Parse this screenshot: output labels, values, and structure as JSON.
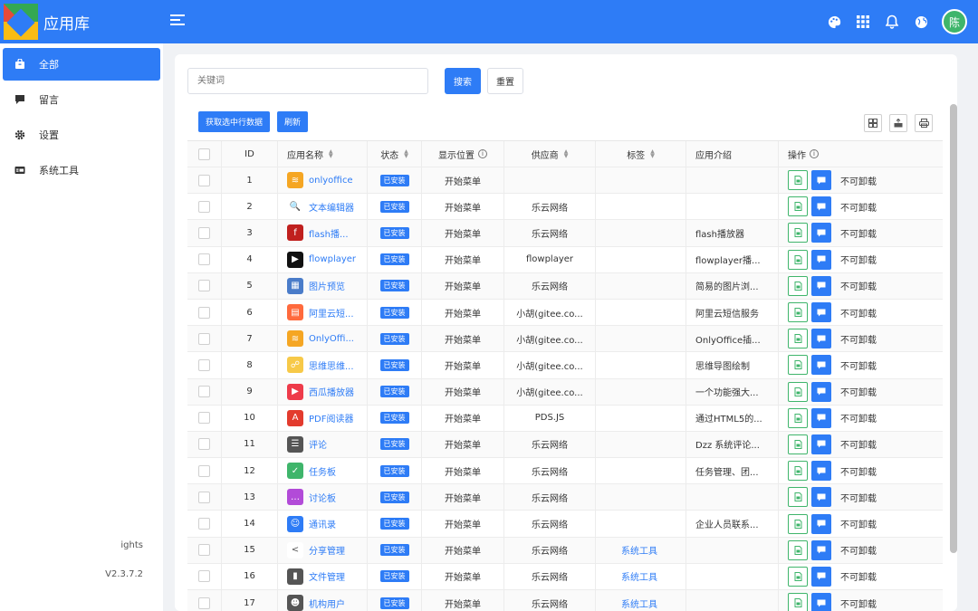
{
  "header": {
    "app_title": "应用库",
    "icons": [
      "menu-icon",
      "palette-icon",
      "apps-grid-icon",
      "bell-icon",
      "globe-icon"
    ],
    "avatar_text": "陈"
  },
  "sidebar": {
    "items": [
      {
        "label": "全部",
        "icon": "bag-icon",
        "active": true
      },
      {
        "label": "留言",
        "icon": "comment-icon",
        "active": false
      },
      {
        "label": "设置",
        "icon": "gear-icon",
        "active": false
      },
      {
        "label": "系统工具",
        "icon": "toolbox-icon",
        "active": false
      }
    ],
    "footer": [
      "",
      "ights",
      "V2.3.7.2"
    ]
  },
  "search": {
    "placeholder": "关键词",
    "search_label": "搜索",
    "reset_label": "重置"
  },
  "toolbar": {
    "get_selected_label": "获取选中行数据",
    "refresh_label": "刷新",
    "tool_icons": [
      "columns-icon",
      "export-icon",
      "print-icon"
    ]
  },
  "table": {
    "headers": {
      "id": "ID",
      "name": "应用名称",
      "status": "状态",
      "position": "显示位置",
      "vendor": "供应商",
      "tag": "标签",
      "intro": "应用介绍",
      "ops": "操作"
    },
    "rows": [
      {
        "id": "1",
        "name": "onlyoffice",
        "icon_color": "#f5a623",
        "icon_glyph": "≋",
        "status": "已安装",
        "position": "开始菜单",
        "vendor": "",
        "tag": "",
        "intro": "",
        "op_text": "不可卸载"
      },
      {
        "id": "2",
        "name": "文本编辑器",
        "icon_color": "#ffffff",
        "icon_glyph": "🔍",
        "status": "已安装",
        "position": "开始菜单",
        "vendor": "乐云网络",
        "tag": "",
        "intro": "",
        "op_text": "不可卸载"
      },
      {
        "id": "3",
        "name": "flash播...",
        "icon_color": "#c0201e",
        "icon_glyph": "f",
        "status": "已安装",
        "position": "开始菜单",
        "vendor": "乐云网络",
        "tag": "",
        "intro": "flash播放器",
        "op_text": "不可卸载"
      },
      {
        "id": "4",
        "name": "flowplayer",
        "icon_color": "#111111",
        "icon_glyph": "▶",
        "status": "已安装",
        "position": "开始菜单",
        "vendor": "flowplayer",
        "tag": "",
        "intro": "flowplayer播...",
        "op_text": "不可卸载"
      },
      {
        "id": "5",
        "name": "图片预览",
        "icon_color": "#4a7cc9",
        "icon_glyph": "▦",
        "status": "已安装",
        "position": "开始菜单",
        "vendor": "乐云网络",
        "tag": "",
        "intro": "简易的图片浏...",
        "op_text": "不可卸载"
      },
      {
        "id": "6",
        "name": "阿里云短...",
        "icon_color": "#ff6a3d",
        "icon_glyph": "▤",
        "status": "已安装",
        "position": "开始菜单",
        "vendor": "小胡(gitee.co...",
        "tag": "",
        "intro": "阿里云短信服务",
        "op_text": "不可卸载"
      },
      {
        "id": "7",
        "name": "OnlyOffi...",
        "icon_color": "#f5a623",
        "icon_glyph": "≋",
        "status": "已安装",
        "position": "开始菜单",
        "vendor": "小胡(gitee.co...",
        "tag": "",
        "intro": "OnlyOffice插...",
        "op_text": "不可卸载"
      },
      {
        "id": "8",
        "name": "思维思维...",
        "icon_color": "#f7c948",
        "icon_glyph": "☍",
        "status": "已安装",
        "position": "开始菜单",
        "vendor": "小胡(gitee.co...",
        "tag": "",
        "intro": "思维导图绘制",
        "op_text": "不可卸载"
      },
      {
        "id": "9",
        "name": "西瓜播放器",
        "icon_color": "#ee3b4a",
        "icon_glyph": "▶",
        "status": "已安装",
        "position": "开始菜单",
        "vendor": "小胡(gitee.co...",
        "tag": "",
        "intro": "一个功能强大...",
        "op_text": "不可卸载"
      },
      {
        "id": "10",
        "name": "PDF阅读器",
        "icon_color": "#e33b2e",
        "icon_glyph": "A",
        "status": "已安装",
        "position": "开始菜单",
        "vendor": "PDS.JS",
        "tag": "",
        "intro": "通过HTML5的...",
        "op_text": "不可卸载"
      },
      {
        "id": "11",
        "name": "评论",
        "icon_color": "#555555",
        "icon_glyph": "☰",
        "status": "已安装",
        "position": "开始菜单",
        "vendor": "乐云网络",
        "tag": "",
        "intro": "Dzz 系统评论...",
        "op_text": "不可卸载"
      },
      {
        "id": "12",
        "name": "任务板",
        "icon_color": "#3fb56b",
        "icon_glyph": "✓",
        "status": "已安装",
        "position": "开始菜单",
        "vendor": "乐云网络",
        "tag": "",
        "intro": "任务管理、团...",
        "op_text": "不可卸载"
      },
      {
        "id": "13",
        "name": "讨论板",
        "icon_color": "#b24bd8",
        "icon_glyph": "…",
        "status": "已安装",
        "position": "开始菜单",
        "vendor": "乐云网络",
        "tag": "",
        "intro": "",
        "op_text": "不可卸载"
      },
      {
        "id": "14",
        "name": "通讯录",
        "icon_color": "#2e7cf6",
        "icon_glyph": "☺",
        "status": "已安装",
        "position": "开始菜单",
        "vendor": "乐云网络",
        "tag": "",
        "intro": "企业人员联系...",
        "op_text": "不可卸载"
      },
      {
        "id": "15",
        "name": "分享管理",
        "icon_color": "#ffffff",
        "icon_glyph": "<",
        "status": "已安装",
        "position": "开始菜单",
        "vendor": "乐云网络",
        "tag": "系统工具",
        "intro": "",
        "op_text": "不可卸载"
      },
      {
        "id": "16",
        "name": "文件管理",
        "icon_color": "#555555",
        "icon_glyph": "▮",
        "status": "已安装",
        "position": "开始菜单",
        "vendor": "乐云网络",
        "tag": "系统工具",
        "intro": "",
        "op_text": "不可卸载"
      },
      {
        "id": "17",
        "name": "机构用户",
        "icon_color": "#555555",
        "icon_glyph": "☻",
        "status": "已安装",
        "position": "开始菜单",
        "vendor": "乐云网络",
        "tag": "系统工具",
        "intro": "",
        "op_text": "不可卸载"
      }
    ]
  },
  "colors": {
    "primary": "#2e7cf6",
    "success": "#3fb56b",
    "background": "#f0f2f5"
  }
}
